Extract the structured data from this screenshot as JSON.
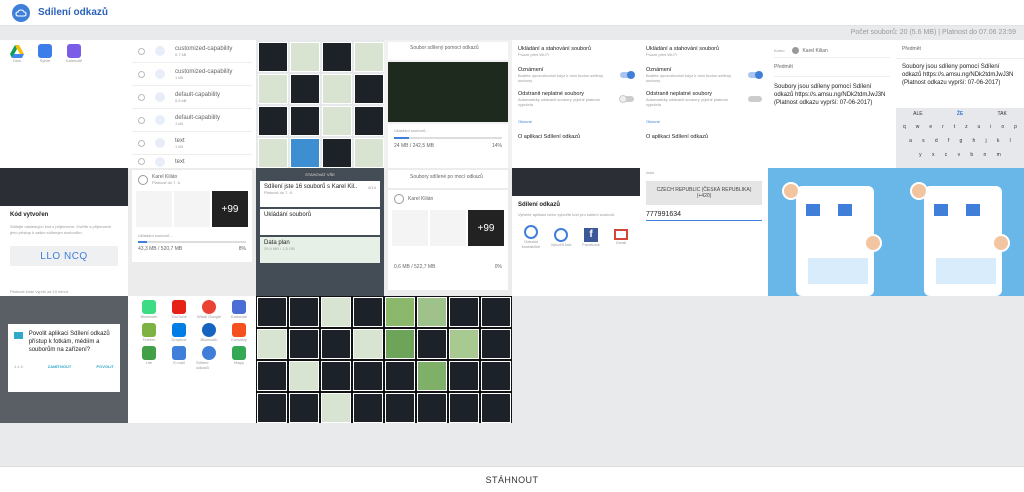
{
  "app": {
    "title": "Sdílení odkazů",
    "download_label": "STÁHNOUT"
  },
  "info": {
    "file_count": "Počet souborů: 20 (5.6 MB)",
    "separator": "|",
    "validity": "Platnost do 07.06 23:59"
  },
  "colors": {
    "accent": "#2a62b8",
    "brand": "#3f7fd9",
    "background": "#e9eaec"
  },
  "tiles": {
    "t1": {
      "apps": [
        "Disk",
        "Sylvie",
        "Kalendář"
      ]
    },
    "t2": {
      "items": [
        {
          "name": "customized-capability",
          "size": "0,7 kB"
        },
        {
          "name": "customized-capability",
          "size": "1 kB"
        },
        {
          "name": "default-capability",
          "size": "0,6 kB"
        },
        {
          "name": "default-capability",
          "size": "1 kB"
        },
        {
          "name": "text",
          "size": "1 kB"
        },
        {
          "name": "text",
          "size": ""
        }
      ]
    },
    "t4": {
      "title": "Soubor sdílený pomocí odkazů",
      "saving": "Ukládání souborů...",
      "progress": "24 MB / 242,5 MB",
      "percent": "14%"
    },
    "t5": {
      "rows": [
        {
          "title": "Ukládání a stahování souborů",
          "desc": "Pouze přes Wi-Fi"
        },
        {
          "title": "Oznámení",
          "desc": "Budete upozorňováni když k vám budou sdíleny soubory"
        },
        {
          "title": "Odstranit neplatné soubory",
          "desc": "Automaticky odstranit soubory, jejichž platnost vypršela"
        },
        {
          "title": "Obecné",
          "desc": ""
        },
        {
          "title": "O aplikaci Sdílení odkazů",
          "desc": ""
        }
      ]
    },
    "t7": {
      "recipient": "Karel Kilian",
      "subject": "Předmět",
      "body": "Soubory jsou sdíleny pomocí Sdílení odkazů https://s.amsu.ng/NDk2tdmJwJ3N (Platnost odkazu vyprší: 07-06-2017)"
    },
    "t8": {
      "subject": "Předmět",
      "body": "Soubory jsou sdíleny pomocí Sdílení odkazů https://s.amsu.ng/NDk2tdmJwJ3N (Platnost odkazu vyprší: 07-06-2017)",
      "suggestions": [
        "ALE",
        "ŽE",
        "TAK"
      ],
      "row1": [
        "q",
        "w",
        "e",
        "r",
        "t",
        "z",
        "u",
        "i",
        "o",
        "p"
      ],
      "row2": [
        "a",
        "s",
        "d",
        "f",
        "g",
        "h",
        "j",
        "k",
        "l"
      ],
      "row3": [
        "y",
        "x",
        "c",
        "v",
        "b",
        "n",
        "m"
      ]
    },
    "t9": {
      "title": "Kód vytvořen",
      "desc": "Sdílejte následující kód s příjemcem. Ověřte s příjemcem jeho přístup k vašim sdíleným souborům.",
      "code": "LLO NCQ",
      "note": "Platnost kódu vyprší za 10 minut"
    },
    "t10": {
      "user": "Karel Kilián",
      "sub": "Platnost do 7. 6.",
      "saving": "Ukládání souborů...",
      "progress": "43,3 MB / 520,7 MB",
      "percent": "8%",
      "badge": "+99"
    },
    "t11": {
      "header": "STAHOVAT VŠE",
      "items": [
        {
          "title": "Sdílení jste 16 souborů s Karel Kil..",
          "sub": "Platnost do 7. 6.",
          "meta": "8/14"
        },
        {
          "title": "Ukládání souborů",
          "sub": "",
          "meta": ""
        },
        {
          "title": "Data plan",
          "sub": "39,9 MB / 1,5 GB",
          "meta": ""
        }
      ]
    },
    "t12": {
      "title": "Soubory sdílené po mocí odkazů",
      "user": "Karel Kilián",
      "progress": "0,6 MB / 522,7 MB",
      "percent": "0%",
      "badge": "+99"
    },
    "t13": {
      "title": "Sdílení odkazů",
      "desc": "Vyberte aplikaci nebo vytvořte kód pro sdílení souborů.",
      "apps": [
        {
          "label": "Odeslat kontaktům"
        },
        {
          "label": "Vytvořit kód"
        },
        {
          "label": "Facebook"
        },
        {
          "label": "Gmail"
        }
      ]
    },
    "t14": {
      "label": "číslo",
      "country": "CZECH REPUBLIC (ČESKÁ REPUBLIKA) (+420)",
      "phone": "777991634"
    },
    "t17": {
      "title": "Povolit aplikaci Sdílení odkazů přístup k fotkám, médiím a souborům na zařízení?",
      "count": "1 z 4",
      "deny": "ZAMÍTNOUT",
      "allow": "POVOLIT"
    },
    "t18": {
      "apps": [
        "Bluetooth",
        "YouTube",
        "Wiadl Google",
        "Kalendář",
        "Telefon",
        "Dropbox",
        "Bluetooth",
        "Kontakty",
        "Lite",
        "E-mail",
        "Sdílení odkazů",
        "Mapy"
      ]
    }
  }
}
